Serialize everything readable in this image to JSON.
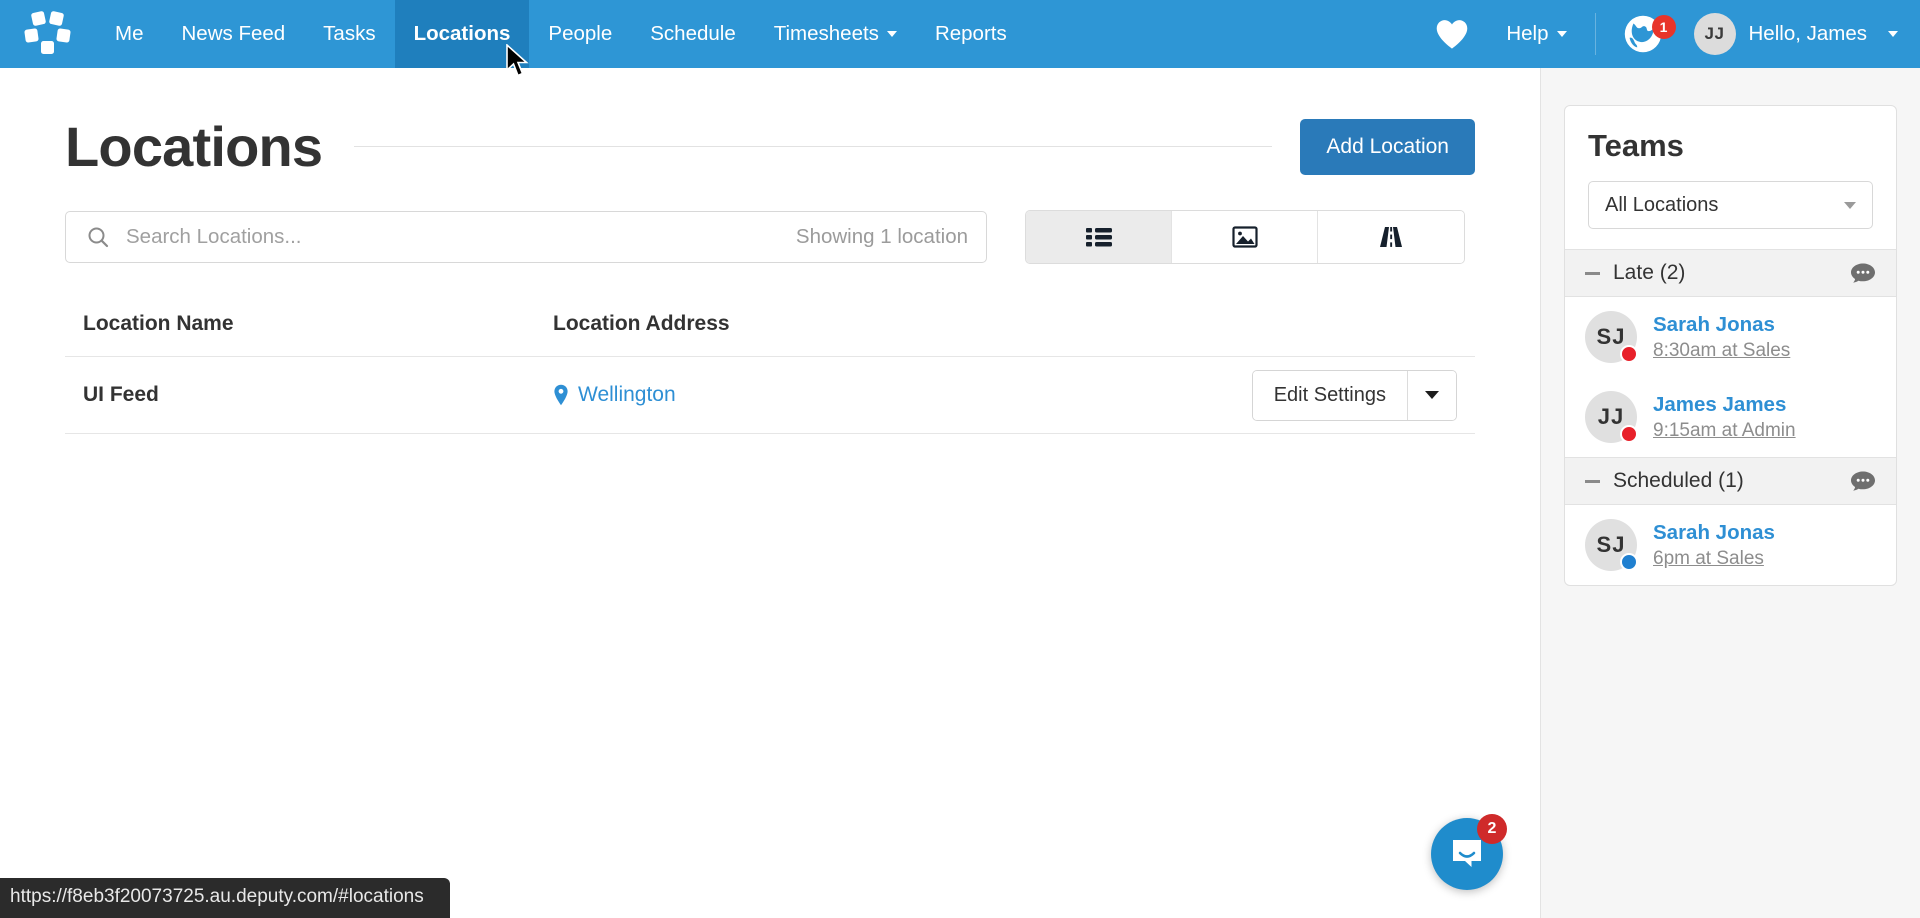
{
  "nav": {
    "logo_icon": "deputy-logo-icon",
    "links": [
      {
        "label": "Me",
        "active": false,
        "has_caret": false
      },
      {
        "label": "News Feed",
        "active": false,
        "has_caret": false
      },
      {
        "label": "Tasks",
        "active": false,
        "has_caret": false
      },
      {
        "label": "Locations",
        "active": true,
        "has_caret": false
      },
      {
        "label": "People",
        "active": false,
        "has_caret": false
      },
      {
        "label": "Schedule",
        "active": false,
        "has_caret": false
      },
      {
        "label": "Timesheets",
        "active": false,
        "has_caret": true
      },
      {
        "label": "Reports",
        "active": false,
        "has_caret": false
      }
    ],
    "heart_icon": "heart-icon",
    "help_label": "Help",
    "globe_icon": "globe-icon",
    "globe_badge": "1",
    "user_initials": "JJ",
    "user_greeting": "Hello, James"
  },
  "main": {
    "page_title": "Locations",
    "add_button": "Add Location",
    "search": {
      "placeholder": "Search Locations...",
      "value": "",
      "icon": "search-icon",
      "count_label": "Showing 1 location"
    },
    "views": [
      {
        "name": "list-view",
        "icon": "list-icon",
        "active": true
      },
      {
        "name": "photo-view",
        "icon": "image-icon",
        "active": false
      },
      {
        "name": "map-view",
        "icon": "road-icon",
        "active": false
      }
    ],
    "table": {
      "headers": [
        "Location Name",
        "Location Address"
      ],
      "rows": [
        {
          "name": "UI Feed",
          "address": "Wellington",
          "address_icon": "map-pin-icon",
          "action_label": "Edit Settings"
        }
      ]
    }
  },
  "sidebar": {
    "title": "Teams",
    "location_filter": {
      "value": "All Locations",
      "caret_icon": "chevron-down-icon"
    },
    "groups": [
      {
        "label": "Late (2)",
        "chat_icon": "chat-bubble-icon",
        "collapse_icon": "minus-icon",
        "members": [
          {
            "initials": "SJ",
            "name": "Sarah Jonas",
            "detail": "8:30am at Sales",
            "status_color": "#e8202a"
          },
          {
            "initials": "JJ",
            "name": "James James",
            "detail": "9:15am at Admin",
            "status_color": "#e8202a"
          }
        ]
      },
      {
        "label": "Scheduled (1)",
        "chat_icon": "chat-bubble-icon",
        "collapse_icon": "minus-icon",
        "members": [
          {
            "initials": "SJ",
            "name": "Sarah Jonas",
            "detail": "6pm at Sales",
            "status_color": "#2080d0"
          }
        ]
      }
    ]
  },
  "chat_widget": {
    "icon": "messenger-icon",
    "badge": "2"
  },
  "status_bar": {
    "url": "https://f8eb3f20073725.au.deputy.com/#locations"
  },
  "colors": {
    "nav_blue": "#2e96d5",
    "nav_active_blue": "#1f7fbd",
    "primary_button": "#2a7ab9",
    "link_blue": "#2e8fd4",
    "badge_red": "#e8342a",
    "sidebar_bg": "#f6f6f6"
  }
}
